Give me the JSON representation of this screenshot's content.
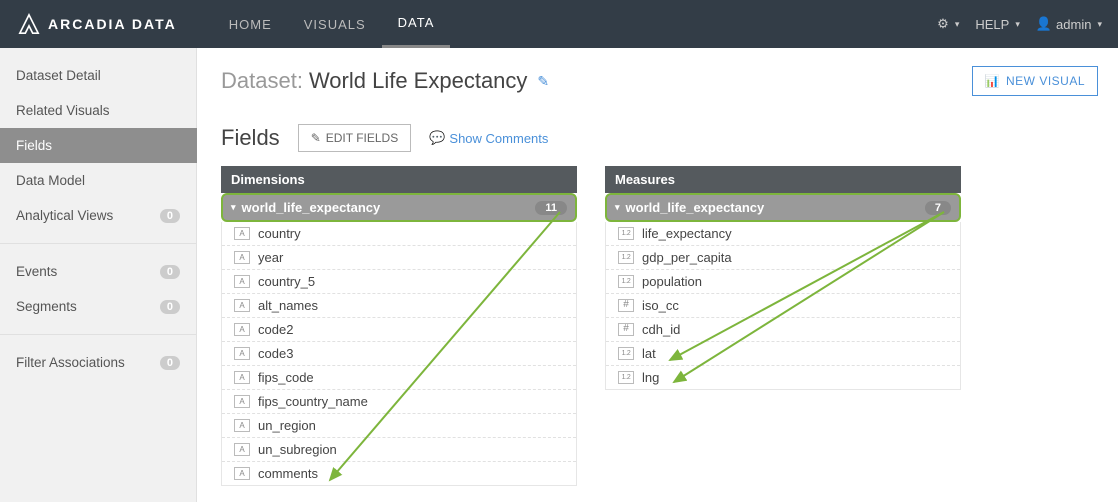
{
  "brand": "ARCADIA DATA",
  "nav": {
    "home": "HOME",
    "visuals": "VISUALS",
    "data": "DATA"
  },
  "topbar": {
    "help": "HELP",
    "user": "admin"
  },
  "sidebar": {
    "datasetDetail": "Dataset Detail",
    "relatedVisuals": "Related Visuals",
    "fields": "Fields",
    "dataModel": "Data Model",
    "analyticalViews": "Analytical Views",
    "analyticalViewsCount": "0",
    "events": "Events",
    "eventsCount": "0",
    "segments": "Segments",
    "segmentsCount": "0",
    "filterAssociations": "Filter Associations",
    "filterAssociationsCount": "0"
  },
  "title": {
    "prefix": "Dataset:",
    "name": "World Life Expectancy",
    "newVisual": "NEW VISUAL"
  },
  "fieldsbar": {
    "title": "Fields",
    "editFields": "EDIT FIELDS",
    "showComments": "Show Comments"
  },
  "dimensionsPanel": {
    "header": "Dimensions",
    "group": "world_life_expectancy",
    "count": "11",
    "fields": [
      {
        "type": "A",
        "name": "country"
      },
      {
        "type": "A",
        "name": "year"
      },
      {
        "type": "A",
        "name": "country_5"
      },
      {
        "type": "A",
        "name": "alt_names"
      },
      {
        "type": "A",
        "name": "code2"
      },
      {
        "type": "A",
        "name": "code3"
      },
      {
        "type": "A",
        "name": "fips_code"
      },
      {
        "type": "A",
        "name": "fips_country_name"
      },
      {
        "type": "A",
        "name": "un_region"
      },
      {
        "type": "A",
        "name": "un_subregion"
      },
      {
        "type": "A",
        "name": "comments"
      }
    ]
  },
  "measuresPanel": {
    "header": "Measures",
    "group": "world_life_expectancy",
    "count": "7",
    "fields": [
      {
        "type": "1.2",
        "name": "life_expectancy"
      },
      {
        "type": "1.2",
        "name": "gdp_per_capita"
      },
      {
        "type": "1.2",
        "name": "population"
      },
      {
        "type": "#",
        "name": "iso_cc"
      },
      {
        "type": "#",
        "name": "cdh_id"
      },
      {
        "type": "1.2",
        "name": "lat"
      },
      {
        "type": "1.2",
        "name": "lng"
      }
    ]
  }
}
